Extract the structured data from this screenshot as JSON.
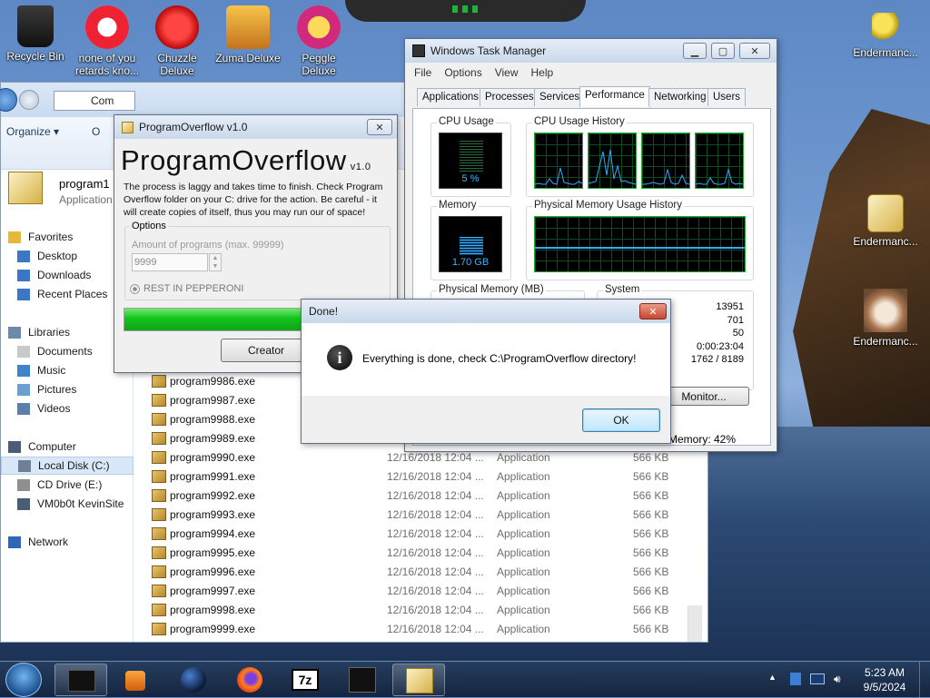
{
  "desktop": {
    "icons": [
      {
        "label": "Recycle Bin",
        "icon": "recycle-bin-icon"
      },
      {
        "label": "none of you retards kno...",
        "icon": "app-icon"
      },
      {
        "label": "Chuzzle Deluxe",
        "icon": "chuzzle-icon"
      },
      {
        "label": "Zuma Deluxe",
        "icon": "zuma-icon"
      },
      {
        "label": "Peggle Deluxe",
        "icon": "peggle-icon"
      }
    ],
    "right_icons": [
      {
        "label": "Endermanc...",
        "icon": "key-icon"
      },
      {
        "label": "Endermanc...",
        "icon": "folder-icon"
      },
      {
        "label": "Endermanc...",
        "icon": "cat-photo-icon"
      }
    ]
  },
  "explorer": {
    "address": "Com",
    "organize": "Organize",
    "organize_extra": "O",
    "selected_name": "program1",
    "selected_type": "Application",
    "nav": [
      {
        "label": "Favorites"
      },
      {
        "label": "Desktop"
      },
      {
        "label": "Downloads"
      },
      {
        "label": "Recent Places"
      },
      {
        "label": "Libraries"
      },
      {
        "label": "Documents"
      },
      {
        "label": "Music"
      },
      {
        "label": "Pictures"
      },
      {
        "label": "Videos"
      },
      {
        "label": "Computer"
      },
      {
        "label": "Local Disk (C:)"
      },
      {
        "label": "CD Drive (E:)"
      },
      {
        "label": "VM0b0t KevinSite"
      },
      {
        "label": "Network"
      }
    ],
    "files": [
      {
        "name": "program9986.exe",
        "date": "",
        "type": "",
        "size": ""
      },
      {
        "name": "program9987.exe",
        "date": "",
        "type": "",
        "size": ""
      },
      {
        "name": "program9988.exe",
        "date": "",
        "type": "",
        "size": ""
      },
      {
        "name": "program9989.exe",
        "date": "",
        "type": "",
        "size": ""
      },
      {
        "name": "program9990.exe",
        "date": "12/16/2018 12:04 ...",
        "type": "Application",
        "size": "566 KB"
      },
      {
        "name": "program9991.exe",
        "date": "12/16/2018 12:04 ...",
        "type": "Application",
        "size": "566 KB"
      },
      {
        "name": "program9992.exe",
        "date": "12/16/2018 12:04 ...",
        "type": "Application",
        "size": "566 KB"
      },
      {
        "name": "program9993.exe",
        "date": "12/16/2018 12:04 ...",
        "type": "Application",
        "size": "566 KB"
      },
      {
        "name": "program9994.exe",
        "date": "12/16/2018 12:04 ...",
        "type": "Application",
        "size": "566 KB"
      },
      {
        "name": "program9995.exe",
        "date": "12/16/2018 12:04 ...",
        "type": "Application",
        "size": "566 KB"
      },
      {
        "name": "program9996.exe",
        "date": "12/16/2018 12:04 ...",
        "type": "Application",
        "size": "566 KB"
      },
      {
        "name": "program9997.exe",
        "date": "12/16/2018 12:04 ...",
        "type": "Application",
        "size": "566 KB"
      },
      {
        "name": "program9998.exe",
        "date": "12/16/2018 12:04 ...",
        "type": "Application",
        "size": "566 KB"
      },
      {
        "name": "program9999.exe",
        "date": "12/16/2018 12:04 ...",
        "type": "Application",
        "size": "566 KB"
      }
    ]
  },
  "taskmgr": {
    "title": "Windows Task Manager",
    "menu": [
      "File",
      "Options",
      "View",
      "Help"
    ],
    "tabs": [
      "Applications",
      "Processes",
      "Services",
      "Performance",
      "Networking",
      "Users"
    ],
    "active_tab": "Performance",
    "cpu_usage_label": "CPU Usage",
    "cpu_usage_value": "5 %",
    "cpu_history_label": "CPU Usage History",
    "memory_label": "Memory",
    "memory_value": "1.70 GB",
    "phys_history_label": "Physical Memory Usage History",
    "phys_memory_label": "Physical Memory (MB)",
    "system_label": "System",
    "system_values": [
      "13951",
      "701",
      "50",
      "0:00:23:04",
      "1762 / 8189"
    ],
    "monitor_button": "Monitor...",
    "status_memory": "Memory: 42%"
  },
  "programoverflow": {
    "title": "ProgramOverflow v1.0",
    "heading": "ProgramOverflow",
    "version": "v1.0",
    "description": "The process is laggy and takes time to finish. Check Program Overflow folder on your C: drive for the action. Be careful - it will create copies of itself, thus you may run our of space!",
    "options_label": "Options",
    "amount_label": "Amount of programs (max. 99999)",
    "amount_value": "9999",
    "radio_label": "REST IN PEPPERONI",
    "creator_button": "Creator",
    "progress": 1.0
  },
  "dialog": {
    "title": "Done!",
    "message": "Everything is done, check C:\\ProgramOverflow directory!",
    "ok_button": "OK"
  },
  "taskbar": {
    "time": "5:23 AM",
    "date": "9/5/2024"
  },
  "colors": {
    "progress_green": "#1fcf2f",
    "graph_green": "#1db33b",
    "graph_line": "#33aaff"
  }
}
